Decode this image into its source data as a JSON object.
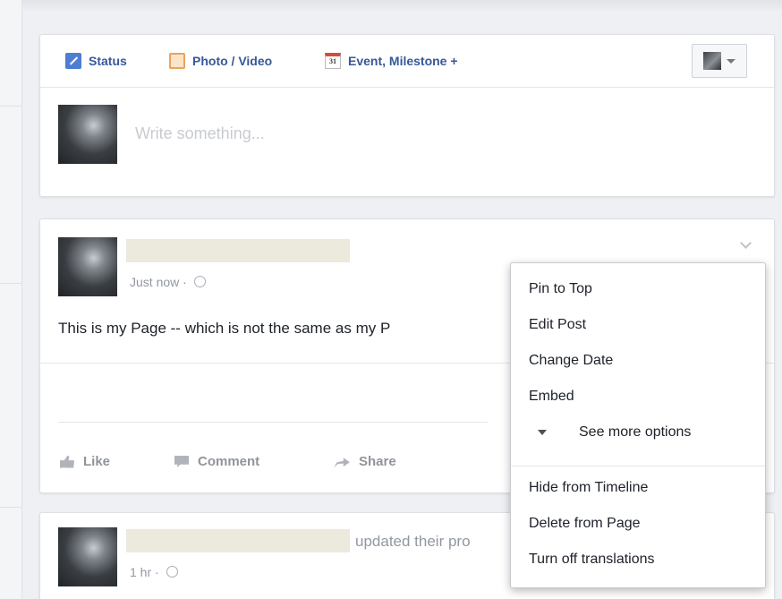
{
  "composer": {
    "tabs": [
      {
        "label": "Status",
        "icon": "pencil-icon"
      },
      {
        "label": "Photo / Video",
        "icon": "photo-icon"
      },
      {
        "label": "Event, Milestone +",
        "icon": "calendar-icon",
        "icon_text": "31"
      }
    ],
    "placeholder": "Write something..."
  },
  "post": {
    "time": "Just now",
    "text": "This is my Page -- which is not the same as my P",
    "actions": {
      "like": "Like",
      "comment": "Comment",
      "share": "Share"
    }
  },
  "post2": {
    "action_text": "updated their pro",
    "time": "1 hr"
  },
  "menu": {
    "items": [
      "Pin to Top",
      "Edit Post",
      "Change Date",
      "Embed",
      "See more options",
      "Hide from Timeline",
      "Delete from Page",
      "Turn off translations"
    ]
  }
}
